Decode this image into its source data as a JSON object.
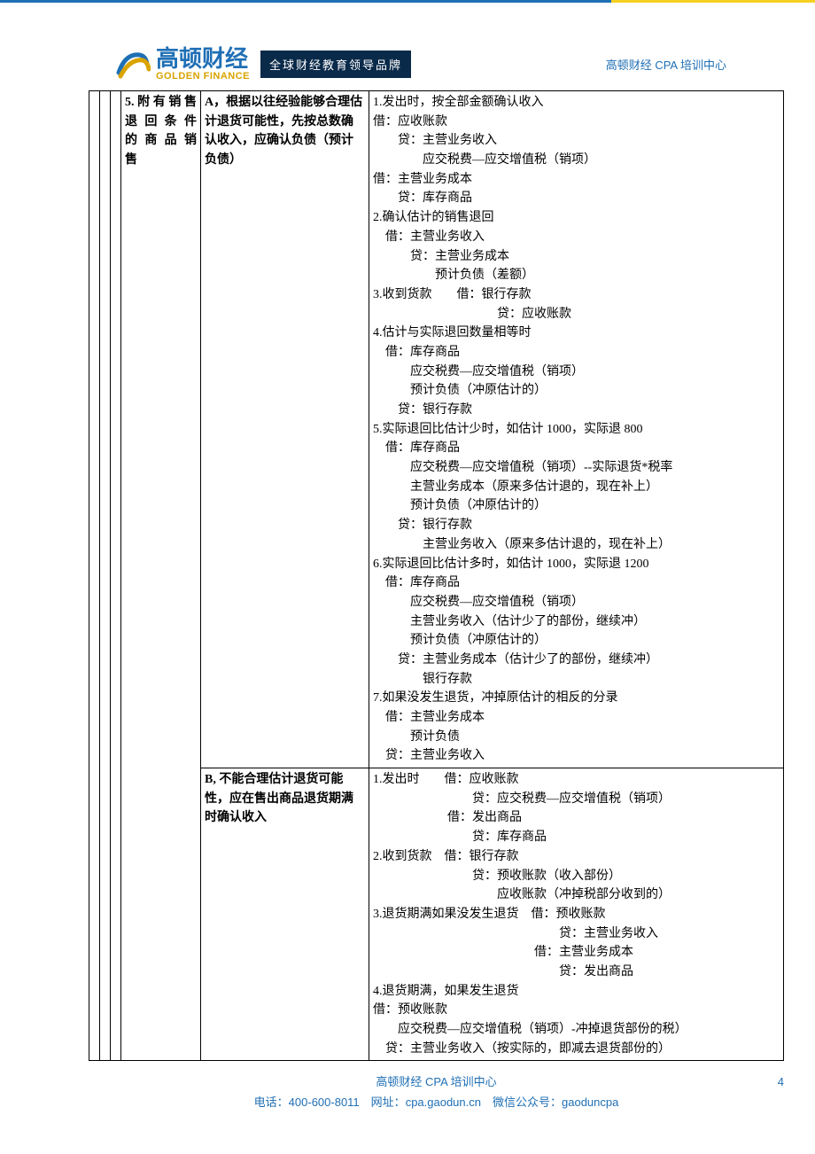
{
  "header": {
    "logo_cn": "高顿财经",
    "logo_en": "GOLDEN FINANCE",
    "slogan": "全球财经教育领导品牌",
    "right_text": "高顿财经 CPA 培训中心"
  },
  "table": {
    "row1": {
      "col_d_a": "5.附有销售",
      "col_d_b": "退回条件",
      "col_d_c": "的商品销",
      "col_d_d": "售",
      "col_e": "A，根据以往经验能够合理估计退货可能性，先按总数确认收入，应确认负债（预计负债）",
      "col_f": [
        "1.发出时，按全部金额确认收入",
        "借：应收账款",
        "　　贷：主营业务收入",
        "　　　　应交税费—应交增值税（销项）",
        "借：主营业务成本",
        "　　贷：库存商品",
        "2.确认估计的销售退回",
        "　借：主营业务收入",
        "　　　贷：主营业务成本",
        "　　　　　预计负债（差额）",
        "3.收到货款　　借：银行存款",
        "　　　　　　　　　　贷：应收账款",
        "4.估计与实际退回数量相等时",
        "　借：库存商品",
        "　　　应交税费—应交增值税（销项）",
        "　　　预计负债（冲原估计的）",
        "　　贷：银行存款",
        "5.实际退回比估计少时，如估计 1000，实际退 800",
        "　借：库存商品",
        "　　　应交税费—应交增值税（销项）--实际退货*税率",
        "　　　主营业务成本（原来多估计退的，现在补上）",
        "　　　预计负债（冲原估计的）",
        "　　贷：银行存款",
        "　　　　主营业务收入（原来多估计退的，现在补上）",
        "6.实际退回比估计多时，如估计 1000，实际退 1200",
        "　借：库存商品",
        "　　　应交税费—应交增值税（销项）",
        "　　　主营业务收入（估计少了的部份，继续冲）",
        "　　　预计负债（冲原估计的）",
        "　　贷：主营业务成本（估计少了的部份，继续冲）",
        "　　　　银行存款",
        "7.如果没发生退货，冲掉原估计的相反的分录",
        "　借：主营业务成本",
        "　　　预计负债",
        "　贷：主营业务收入"
      ]
    },
    "row2": {
      "col_e": "B, 不能合理估计退货可能性，应在售出商品退货期满时确认收入",
      "col_f": [
        "1.发出时　　借：应收账款",
        "　　　　　　　　贷：应交税费—应交增值税（销项）",
        "　　　　　　借：发出商品",
        "　　　　　　　　贷：库存商品",
        "2.收到货款　借：银行存款",
        "　　　　　　　　贷：预收账款（收入部份）",
        "　　　　　　　　　　应收账款（冲掉税部分收到的）",
        "3.退货期满如果没发生退货　借：预收账款",
        "　　　　　　　　　　　　　　　贷：主营业务收入",
        "　　　　　　　　　　　　　借：主营业务成本",
        "　　　　　　　　　　　　　　　贷：发出商品",
        "4.退货期满，如果发生退货",
        "借：预收账款",
        "　　应交税费—应交增值税（销项）-冲掉退货部份的税）",
        "　贷：主营业务收入（按实际的，即减去退货部份的）"
      ]
    }
  },
  "footer": {
    "line1": "高顿财经 CPA 培训中心",
    "line2_tel_label": "电话：",
    "line2_tel": "400-600-8011",
    "line2_url_label": "　网址：",
    "line2_url": "cpa.gaodun.cn",
    "line2_wx_label": "　微信公众号：",
    "line2_wx": "gaoduncpa",
    "page_num": "4"
  }
}
